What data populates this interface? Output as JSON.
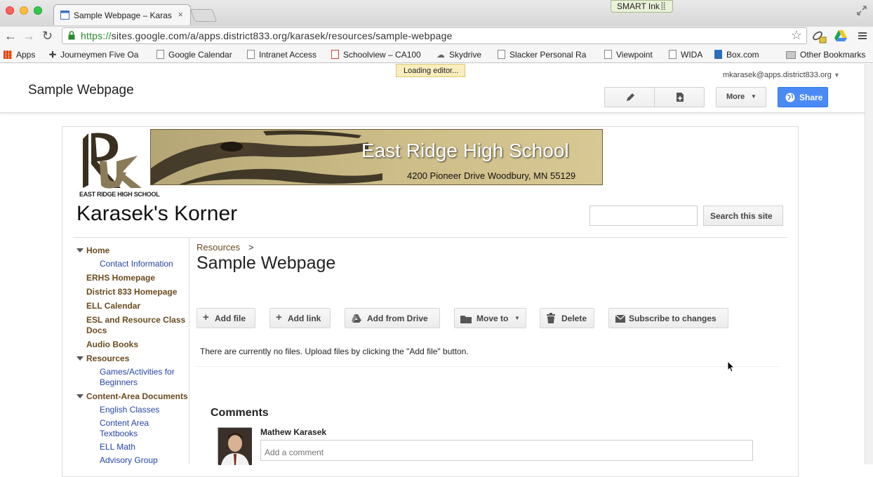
{
  "browser": {
    "tab_title": "Sample Webpage – Karasek",
    "tab_close": "×",
    "smart_ink": "SMART Ink",
    "url_scheme": "https://",
    "url_rest": "sites.google.com/a/apps.district833.org/karasek/resources/sample-webpage",
    "loading_tip": "Loading editor...",
    "bookmarks": [
      "Apps",
      "Journeymen Five Oa",
      "Google Calendar",
      "Intranet Access",
      "Schoolview – CA100",
      "Skydrive",
      "Slacker Personal Ra",
      "Viewpoint",
      "WIDA",
      "Box.com",
      "Other Bookmarks"
    ]
  },
  "sites_header": {
    "site_name": "Sample Webpage",
    "user_email": "mkarasek@apps.district833.org",
    "more_label": "More",
    "share_label": "Share"
  },
  "banner": {
    "logo_caption": "EAST RIDGE HIGH SCHOOL",
    "title": "East Ridge High School",
    "address": "4200 Pioneer Drive   Woodbury, MN 55129"
  },
  "site_title": "Karasek's Korner",
  "search": {
    "button_label": "Search this site"
  },
  "sidebar": {
    "items": [
      {
        "label": "Home",
        "type": "top",
        "expanded": true
      },
      {
        "label": "Contact Information",
        "type": "sub"
      },
      {
        "label": "ERHS Homepage",
        "type": "top"
      },
      {
        "label": "District 833 Homepage",
        "type": "top"
      },
      {
        "label": "ELL Calendar",
        "type": "top"
      },
      {
        "label": "ESL and Resource Class Docs",
        "type": "top"
      },
      {
        "label": "Audio Books",
        "type": "top"
      },
      {
        "label": "Resources",
        "type": "top",
        "expanded": true
      },
      {
        "label": "Games/Activities for Beginners",
        "type": "sub"
      },
      {
        "label": "Content-Area Documents",
        "type": "top",
        "expanded": true
      },
      {
        "label": "English Classes",
        "type": "sub"
      },
      {
        "label": "Content Area Textbooks",
        "type": "sub"
      },
      {
        "label": "ELL Math",
        "type": "sub"
      },
      {
        "label": "Advisory Group",
        "type": "sub"
      }
    ]
  },
  "main": {
    "breadcrumb": "Resources",
    "breadcrumb_sep": ">",
    "page_title": "Sample Webpage",
    "actions": {
      "add_file": "Add file",
      "add_link": "Add link",
      "add_from_drive": "Add from Drive",
      "move_to": "Move to",
      "delete": "Delete",
      "subscribe": "Subscribe to changes"
    },
    "no_files_text": "There are currently no files. Upload files by clicking the \"Add file\" button.",
    "comments_title": "Comments",
    "commenter": "Mathew Karasek",
    "comment_placeholder": "Add a comment"
  },
  "colors": {
    "nav_top": "#6b4a1f",
    "nav_sub": "#2545a6",
    "share_blue": "#4a8af4"
  }
}
